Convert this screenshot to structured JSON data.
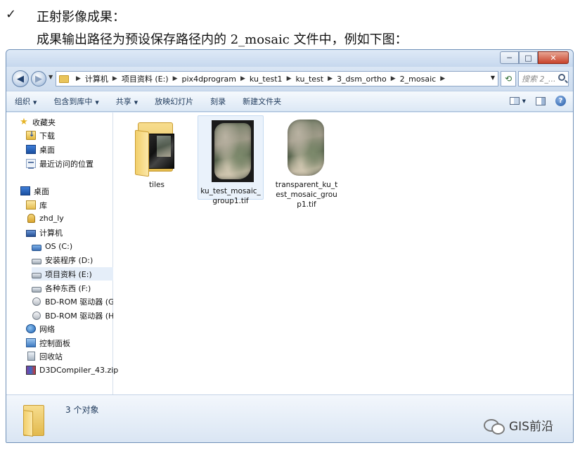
{
  "document": {
    "check_mark": "✓",
    "line1": "正射影像成果：",
    "line2": "成果输出路径为预设保存路径内的 2_mosaic 文件中，例如下图："
  },
  "window": {
    "min_glyph": "─",
    "max_glyph": "□",
    "close_glyph": "✕"
  },
  "address": {
    "crumbs": [
      "计算机",
      "项目资料 (E:)",
      "pix4dprogram",
      "ku_test1",
      "ku_test",
      "3_dsm_ortho",
      "2_mosaic"
    ],
    "search_placeholder": "搜索 2_..."
  },
  "toolbar": {
    "organize": "组织",
    "include_library": "包含到库中",
    "share": "共享",
    "slideshow": "放映幻灯片",
    "burn": "刻录",
    "new_folder": "新建文件夹"
  },
  "sidebar": {
    "items": [
      {
        "label": "收藏夹",
        "icon": "star-icon"
      },
      {
        "label": "下载",
        "icon": "download-folder-icon"
      },
      {
        "label": "桌面",
        "icon": "desktop-icon"
      },
      {
        "label": "最近访问的位置",
        "icon": "recent-places-icon"
      },
      {
        "label": "桌面",
        "icon": "desktop-icon"
      },
      {
        "label": "库",
        "icon": "library-icon"
      },
      {
        "label": "zhd_ly",
        "icon": "user-folder-icon"
      },
      {
        "label": "计算机",
        "icon": "computer-icon"
      },
      {
        "label": "OS (C:)",
        "icon": "os-drive-icon"
      },
      {
        "label": "安装程序 (D:)",
        "icon": "drive-icon"
      },
      {
        "label": "项目资料 (E:)",
        "icon": "drive-icon"
      },
      {
        "label": "各种东西 (F:)",
        "icon": "drive-icon"
      },
      {
        "label": "BD-ROM 驱动器 (G:",
        "icon": "bd-rom-icon"
      },
      {
        "label": "BD-ROM 驱动器 (H:",
        "icon": "bd-rom-icon"
      },
      {
        "label": "网络",
        "icon": "network-icon"
      },
      {
        "label": "控制面板",
        "icon": "control-panel-icon"
      },
      {
        "label": "回收站",
        "icon": "recycle-bin-icon"
      },
      {
        "label": "D3DCompiler_43.zip",
        "icon": "zip-archive-icon"
      }
    ]
  },
  "files": [
    {
      "label": "tiles",
      "icon": "folder-icon"
    },
    {
      "label": "ku_test_mosaic_group1.tif",
      "icon": "orthomosaic-thumbnail-icon"
    },
    {
      "label": "transparent_ku_test_mosaic_group1.tif",
      "icon": "transparent-orthomosaic-thumbnail-icon"
    }
  ],
  "status": {
    "count_text": "3 个对象"
  },
  "watermark": {
    "text": "GIS前沿"
  }
}
